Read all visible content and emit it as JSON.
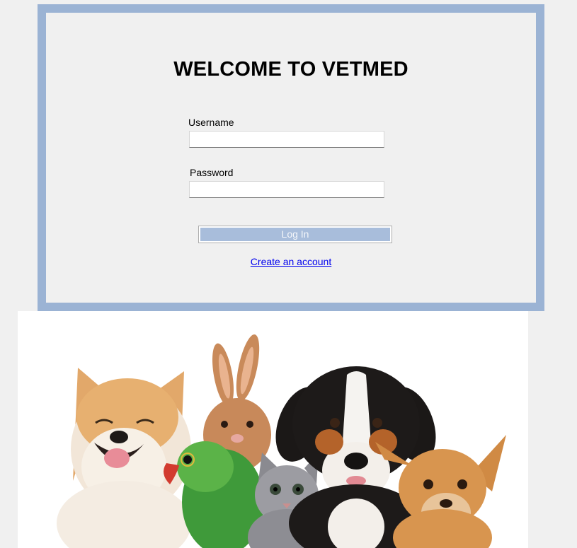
{
  "login": {
    "title": "WELCOME TO VETMED",
    "username_label": "Username",
    "username_value": "",
    "password_label": "Password",
    "password_value": "",
    "login_button_label": "Log In",
    "create_account_link": "Create an account"
  },
  "colors": {
    "frame_border": "#9bb3d4",
    "panel_background": "#f0f0f0",
    "button_fill": "#a8bddb",
    "link": "#0000ee"
  },
  "image": {
    "subject": "group of pets: dog, rabbit, parrot, kitten, puppy, chihuahua"
  }
}
